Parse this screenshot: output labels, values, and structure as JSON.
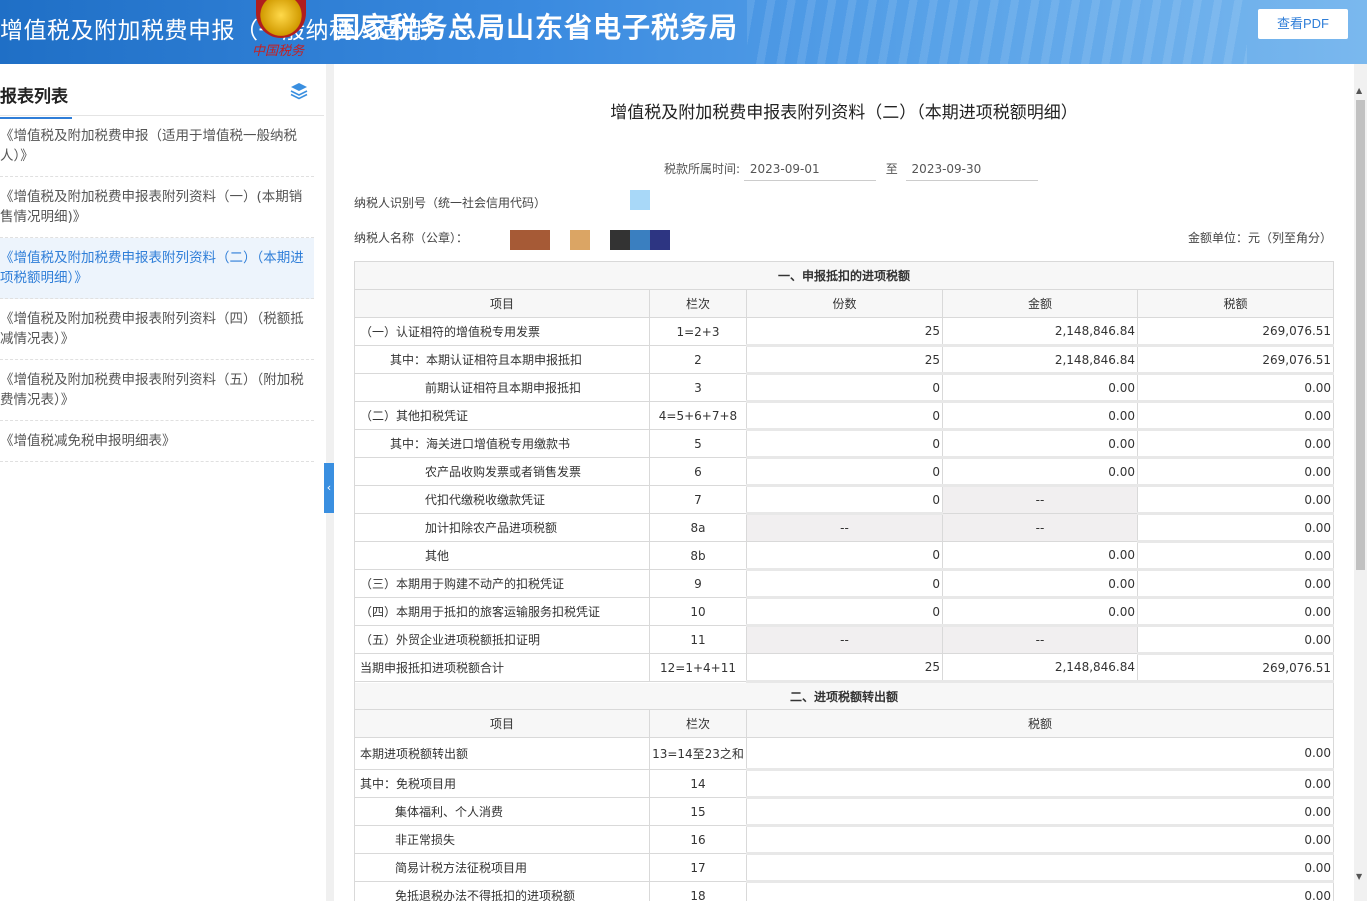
{
  "header": {
    "title": "增值税及附加税费申报（一般纳税人适用）",
    "bureau": "国家税务总局山东省电子税务局",
    "emblem_caption": "中国税务",
    "view_pdf": "查看PDF"
  },
  "sidebar": {
    "title": "报表列表",
    "items": [
      {
        "label": "《增值税及附加税费申报（适用于增值税一般纳税人）》"
      },
      {
        "label": "《增值税及附加税费申报表附列资料（一）(本期销售情况明细)》"
      },
      {
        "label": "《增值税及附加税费申报表附列资料（二）（本期进项税额明细）》"
      },
      {
        "label": "《增值税及附加税费申报表附列资料（四）（税额抵减情况表）》"
      },
      {
        "label": "《增值税及附加税费申报表附列资料（五）（附加税费情况表）》"
      },
      {
        "label": "《增值税减免税申报明细表》"
      }
    ]
  },
  "doc": {
    "title": "增值税及附加税费申报表附列资料（二）（本期进项税额明细）",
    "period_label": "税款所属时间:",
    "period_start": "2023-09-01",
    "period_sep": "至",
    "period_end": "2023-09-30",
    "taxpayer_id_label": "纳税人识别号（统一社会信用代码）",
    "taxpayer_name_label": "纳税人名称（公章）：",
    "unit_label": "金额单位：元（列至角分）"
  },
  "colors": {
    "accent": "#2f7ed8",
    "header_start": "#1f6fc6",
    "disabled_cell": "#f1eff0",
    "mask_colors": [
      "#a65a36",
      "#dba564",
      "#333333",
      "#3a7fc0",
      "#2d3582",
      "#a8d8f8"
    ]
  },
  "table1": {
    "section": "一、申报抵扣的进项税额",
    "headers": [
      "项目",
      "栏次",
      "份数",
      "金额",
      "税额"
    ],
    "rows": [
      {
        "item": "（一）认证相符的增值税专用发票",
        "col": "1=2+3",
        "count": "25",
        "amount": "2,148,846.84",
        "tax": "269,076.51"
      },
      {
        "item": "其中：本期认证相符且本期申报抵扣",
        "col": "2",
        "count": "25",
        "amount": "2,148,846.84",
        "tax": "269,076.51"
      },
      {
        "item": "前期认证相符且本期申报抵扣",
        "col": "3",
        "count": "0",
        "amount": "0.00",
        "tax": "0.00"
      },
      {
        "item": "（二）其他扣税凭证",
        "col": "4=5+6+7+8",
        "count": "0",
        "amount": "0.00",
        "tax": "0.00"
      },
      {
        "item": "其中：海关进口增值税专用缴款书",
        "col": "5",
        "count": "0",
        "amount": "0.00",
        "tax": "0.00"
      },
      {
        "item": "农产品收购发票或者销售发票",
        "col": "6",
        "count": "0",
        "amount": "0.00",
        "tax": "0.00"
      },
      {
        "item": "代扣代缴税收缴款凭证",
        "col": "7",
        "count": "0",
        "amount": "--",
        "tax": "0.00"
      },
      {
        "item": "加计扣除农产品进项税额",
        "col": "8a",
        "count": "--",
        "amount": "--",
        "tax": "0.00"
      },
      {
        "item": "其他",
        "col": "8b",
        "count": "0",
        "amount": "0.00",
        "tax": "0.00"
      },
      {
        "item": "（三）本期用于购建不动产的扣税凭证",
        "col": "9",
        "count": "0",
        "amount": "0.00",
        "tax": "0.00"
      },
      {
        "item": "（四）本期用于抵扣的旅客运输服务扣税凭证",
        "col": "10",
        "count": "0",
        "amount": "0.00",
        "tax": "0.00"
      },
      {
        "item": "（五）外贸企业进项税额抵扣证明",
        "col": "11",
        "count": "--",
        "amount": "--",
        "tax": "0.00"
      },
      {
        "item": "当期申报抵扣进项税额合计",
        "col": "12=1+4+11",
        "count": "25",
        "amount": "2,148,846.84",
        "tax": "269,076.51"
      }
    ]
  },
  "table2": {
    "section": "二、进项税额转出额",
    "headers": [
      "项目",
      "栏次",
      "税额"
    ],
    "rows": [
      {
        "item": "本期进项税额转出额",
        "col": "13=14至23之和",
        "tax": "0.00"
      },
      {
        "item": "其中：免税项目用",
        "col": "14",
        "tax": "0.00"
      },
      {
        "item": "集体福利、个人消费",
        "col": "15",
        "tax": "0.00"
      },
      {
        "item": "非正常损失",
        "col": "16",
        "tax": "0.00"
      },
      {
        "item": "简易计税方法征税项目用",
        "col": "17",
        "tax": "0.00"
      },
      {
        "item": "免抵退税办法不得抵扣的进项税额",
        "col": "18",
        "tax": "0.00"
      }
    ]
  }
}
